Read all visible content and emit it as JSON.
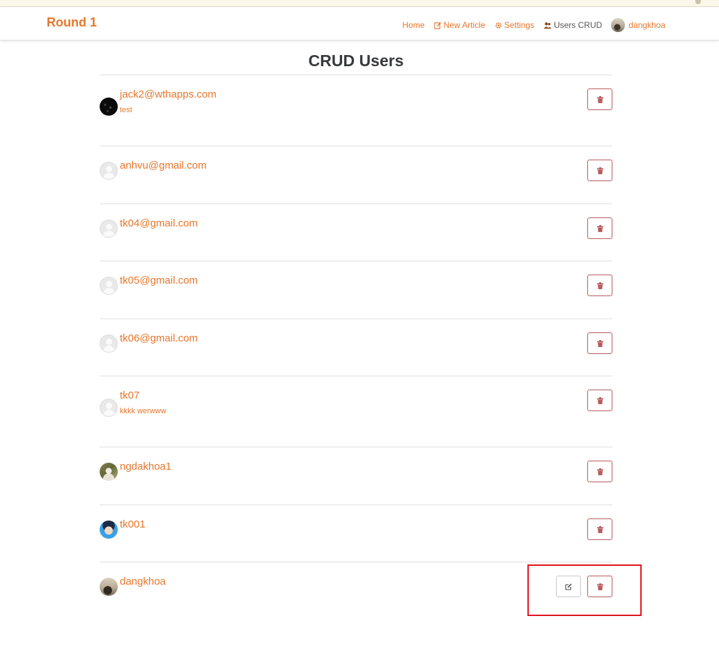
{
  "navbar": {
    "brand": "Round 1",
    "links": {
      "home": "Home",
      "new_article": "New Article",
      "settings": "Settings",
      "users_crud": "Users CRUD",
      "profile": "dangkhoa"
    }
  },
  "page": {
    "title": "CRUD Users"
  },
  "users": [
    {
      "name": "jack2@wthapps.com",
      "bio": "test",
      "avatar": "dark-starry-avatar"
    },
    {
      "name": "anhvu@gmail.com",
      "bio": "",
      "avatar": "default-avatar"
    },
    {
      "name": "tk04@gmail.com",
      "bio": "",
      "avatar": "default-avatar"
    },
    {
      "name": "tk05@gmail.com",
      "bio": "",
      "avatar": "default-avatar"
    },
    {
      "name": "tk06@gmail.com",
      "bio": "",
      "avatar": "default-avatar"
    },
    {
      "name": "tk07",
      "bio": "kkkk werwww",
      "avatar": "default-avatar"
    },
    {
      "name": "ngdakhoa1",
      "bio": "",
      "avatar": "photo-avatar"
    },
    {
      "name": "tk001",
      "bio": "",
      "avatar": "anime-avatar"
    },
    {
      "name": "dangkhoa",
      "bio": "",
      "avatar": "photo-avatar"
    }
  ],
  "icons": {
    "delete": "trash-icon",
    "edit": "edit-icon",
    "new_article": "pencil-square-icon",
    "settings": "gear-icon",
    "users_crud": "users-icon"
  },
  "colors": {
    "accent": "#e8762b",
    "delete_border": "#b85c5c",
    "highlight": "#e0141e"
  }
}
